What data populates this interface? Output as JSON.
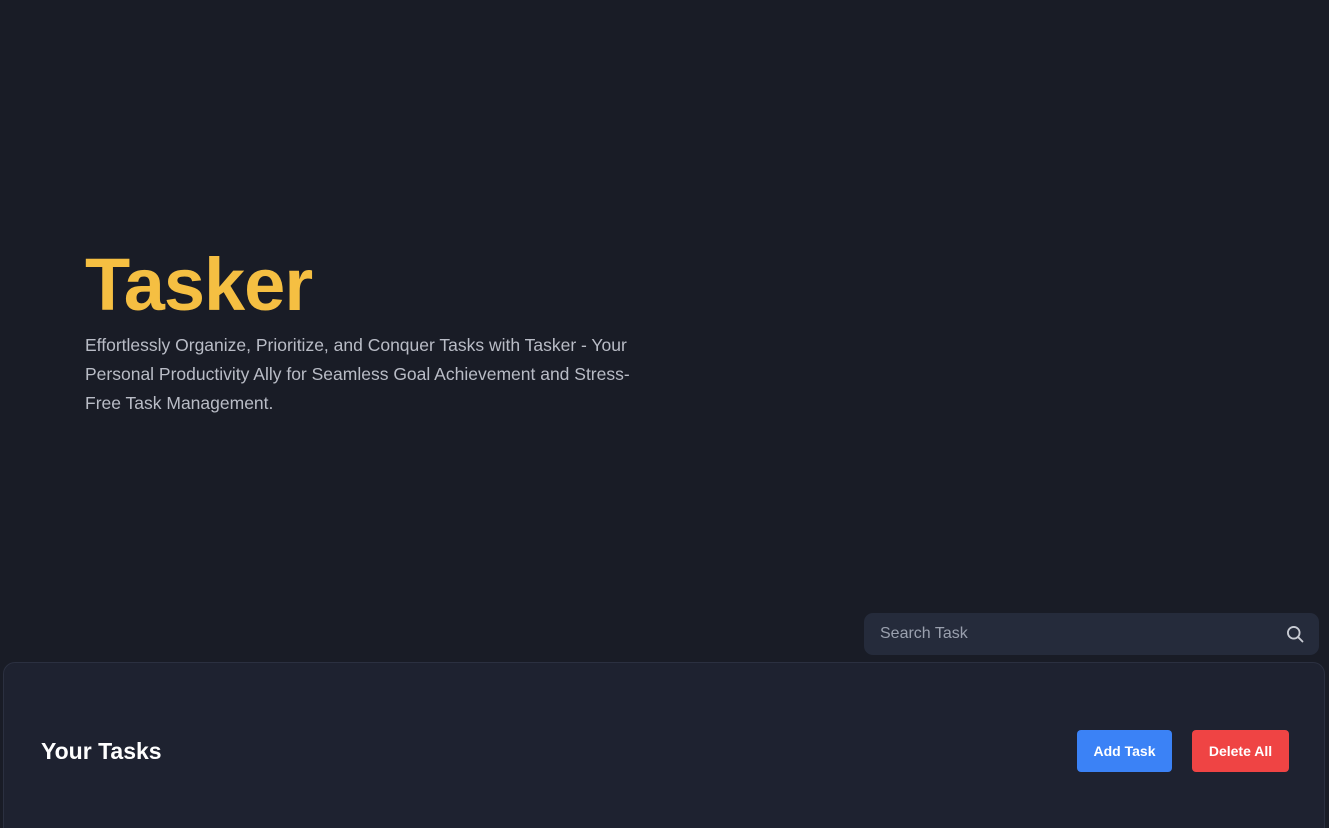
{
  "hero": {
    "title": "Tasker",
    "tagline": "Effortlessly Organize, Prioritize, and Conquer Tasks with Tasker - Your Personal Productivity Ally for Seamless Goal Achievement and Stress-Free Task Management."
  },
  "search": {
    "placeholder": "Search Task",
    "value": "",
    "icon": "search-icon"
  },
  "tasks": {
    "title": "Your Tasks",
    "add_label": "Add Task",
    "delete_all_label": "Delete All"
  },
  "colors": {
    "background": "#191c26",
    "accent": "#f5bf42",
    "add_button": "#3b82f6",
    "delete_button": "#ef4444"
  }
}
